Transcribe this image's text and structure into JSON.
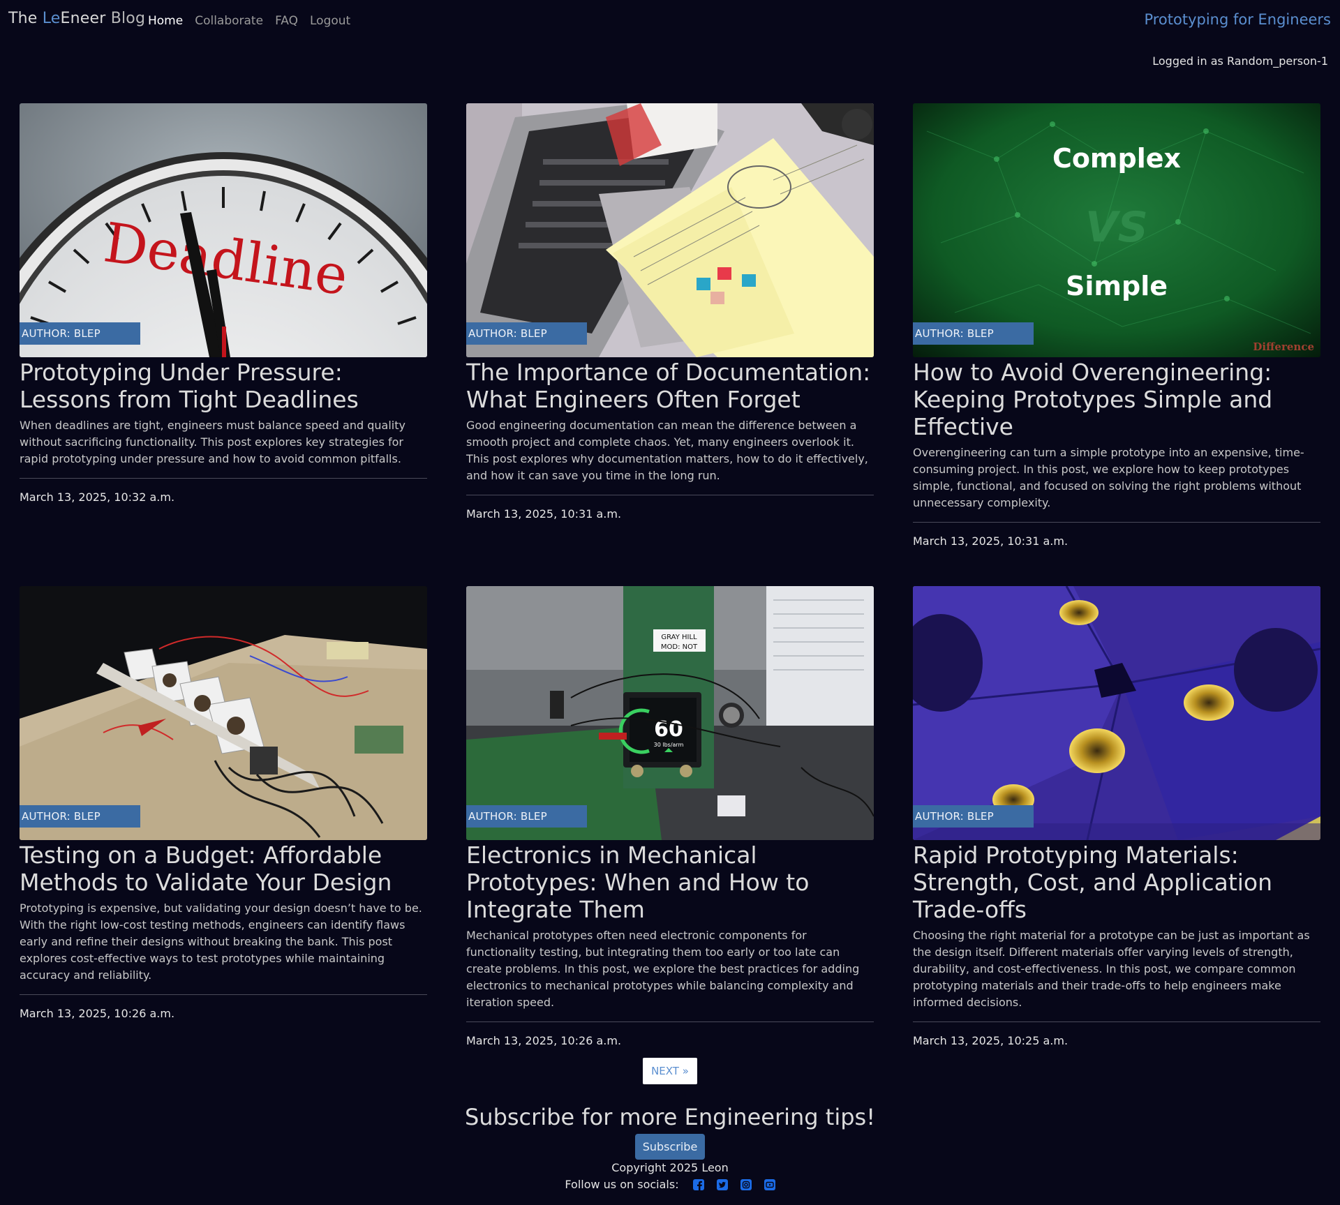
{
  "nav": {
    "brand_pre": "The ",
    "brand_le": "Le",
    "brand_eneer": "Eneer",
    "brand_blog": " Blog",
    "links": [
      "Home",
      "Collaborate",
      "FAQ",
      "Logout"
    ],
    "right_title": "Prototyping for Engineers",
    "logged_in": "Logged in as Random_person-1"
  },
  "posts": [
    {
      "image": "deadline-clock",
      "image_text": "Deadline",
      "author": "AUTHOR: BLEP",
      "title": "Prototyping Under Pressure: Lessons from Tight Deadlines",
      "description": "When deadlines are tight, engineers must balance speed and quality without sacrificing functionality. This post explores key strategies for rapid prototyping under pressure and how to avoid common pitfalls.",
      "date": "March 13, 2025, 10:32 a.m."
    },
    {
      "image": "laptop-notebook",
      "image_text": "",
      "author": "AUTHOR: BLEP",
      "title": "The Importance of Documentation: What Engineers Often Forget",
      "description": "Good engineering documentation can mean the difference between a smooth project and complete chaos. Yet, many engineers overlook it. This post explores why documentation matters, how to do it effectively, and how it can save you time in the long run.",
      "date": "March 13, 2025, 10:31 a.m."
    },
    {
      "image": "complex-vs-simple",
      "image_text": "Complex",
      "image_text2": "VS",
      "image_text3": "Simple",
      "image_text4": "Difference",
      "author": "AUTHOR: BLEP",
      "title": "How to Avoid Overengineering: Keeping Prototypes Simple and Effective",
      "description": "Overengineering can turn a simple prototype into an expensive, time-consuming project. In this post, we explore how to keep prototypes simple, functional, and focused on solving the right problems without unnecessary complexity.",
      "date": "March 13, 2025, 10:31 a.m."
    },
    {
      "image": "test-rig-table",
      "image_text": "",
      "author": "AUTHOR: BLEP",
      "title": "Testing on a Budget: Affordable Methods to Validate Your Design",
      "description": "Prototyping is expensive, but validating your design doesn’t have to be. With the right low-cost testing methods, engineers can identify flaws early and refine their designs without breaking the bank. This post explores cost-effective ways to test prototypes while maintaining accuracy and reliability.",
      "date": "March 13, 2025, 10:26 a.m."
    },
    {
      "image": "electronics-display",
      "image_text": "60",
      "image_text2": "30 lbs/arm",
      "image_text3": "GRAY HILL",
      "image_text4": "MOD: NOT",
      "author": "AUTHOR: BLEP",
      "title": "Electronics in Mechanical Prototypes: When and How to Integrate Them",
      "description": "Mechanical prototypes often need electronic components for functionality testing, but integrating them too early or too late can create problems. In this post, we explore the best practices for adding electronics to mechanical prototypes while balancing complexity and iteration speed.",
      "date": "March 13, 2025, 10:26 a.m."
    },
    {
      "image": "purple-print-inserts",
      "image_text": "",
      "author": "AUTHOR: BLEP",
      "title": "Rapid Prototyping Materials: Strength, Cost, and Application Trade-offs",
      "description": "Choosing the right material for a prototype can be just as important as the design itself. Different materials offer varying levels of strength, durability, and cost-effectiveness. In this post, we compare common prototyping materials and their trade-offs to help engineers make informed decisions.",
      "date": "March 13, 2025, 10:25 a.m."
    }
  ],
  "pagination": {
    "next_label": "NEXT »"
  },
  "footer": {
    "subscribe_title": "Subscribe for more Engineering tips!",
    "subscribe_button": "Subscribe",
    "copyright": "Copyright 2025 Leon",
    "follow_label": "Follow us on socials:",
    "socials": [
      "facebook-icon",
      "twitter-icon",
      "instagram-icon",
      "youtube-icon"
    ]
  },
  "colors": {
    "background": "#070719",
    "accent": "#5b8fd0",
    "badge": "#3b6ba3",
    "social": "#1b6be6"
  }
}
